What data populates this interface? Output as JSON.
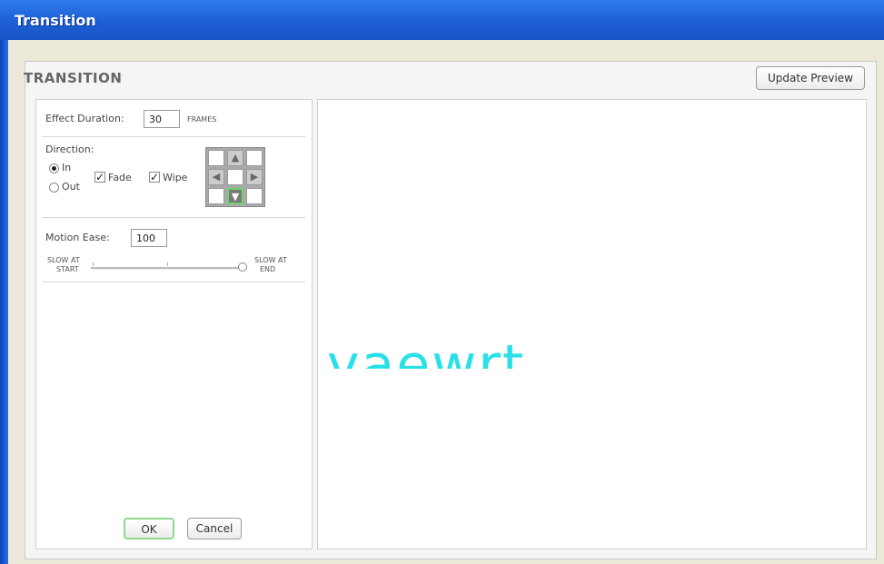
{
  "window": {
    "title": "Transition"
  },
  "panel": {
    "title": "TRANSITION",
    "update_preview_label": "Update Preview"
  },
  "effect": {
    "label": "Effect Duration:",
    "value": "30",
    "unit": "FRAMES"
  },
  "direction": {
    "label": "Direction:",
    "in_label": "In",
    "out_label": "Out",
    "selected": "In",
    "fade_label": "Fade",
    "fade_checked": true,
    "wipe_label": "Wipe",
    "wipe_checked": true,
    "check_mark": "✓",
    "arrows": {
      "up": "▲",
      "left": "◀",
      "right": "▶",
      "down": "▼"
    },
    "selected_arrow": "down"
  },
  "motion_ease": {
    "label": "Motion Ease:",
    "value": "100",
    "slow_start_line1": "SLOW AT",
    "slow_start_line2": "START",
    "slow_end_line1": "SLOW AT",
    "slow_end_line2": "END",
    "slider_fraction": 1.0
  },
  "buttons": {
    "ok": "OK",
    "cancel": "Cancel"
  },
  "preview": {
    "text": "vaewrt",
    "text_color": "#29e0e8"
  },
  "colors": {
    "titlebar": "#1c5fd6",
    "window_bg": "#ece9d8",
    "ok_border": "#8fd88f"
  }
}
